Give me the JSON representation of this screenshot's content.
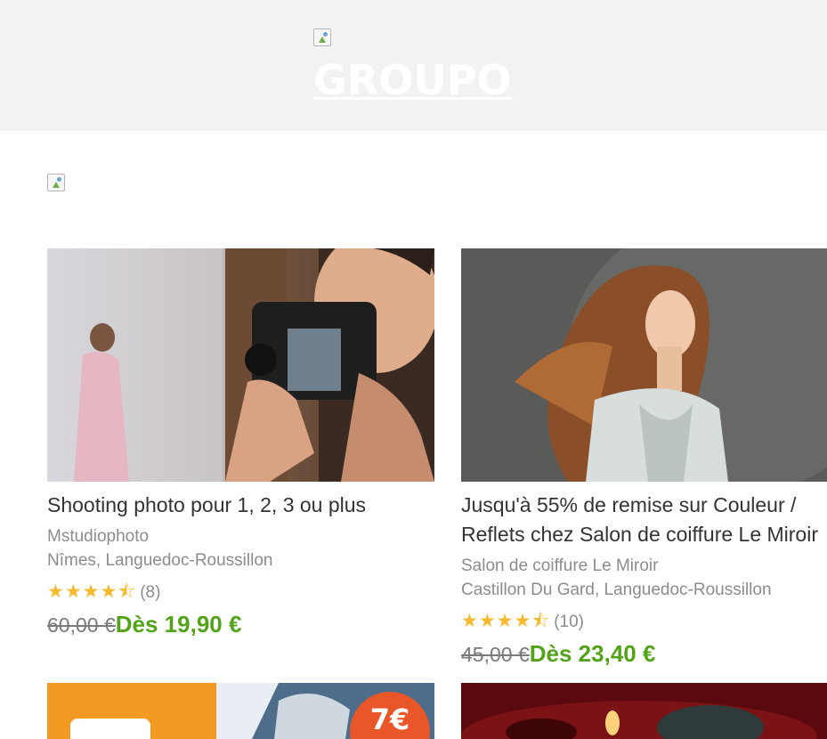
{
  "header": {
    "logo_text": "GROUPO"
  },
  "deals": [
    {
      "title": "Shooting photo pour 1, 2, 3 ou plus",
      "merchant": "Mstudiophoto",
      "location": "Nîmes, Languedoc-Roussillon",
      "rating": 4.5,
      "stars": "★★★★⯪",
      "review_count": "(8)",
      "old_price": "60,00 €",
      "new_price": "Dès 19,90 €"
    },
    {
      "title_line1": "Jusqu'à 55% de remise sur Couleur /",
      "title_line2": "Reflets chez Salon de coiffure Le Miroir",
      "merchant": "Salon de coiffure Le Miroir",
      "location": "Castillon Du Gard, Languedoc-Roussillon",
      "rating": 4.5,
      "stars": "★★★★⯪",
      "review_count": "(10)",
      "old_price": "45,00 €",
      "new_price": "Dès 23,40 €"
    },
    {
      "badge": "7€"
    },
    {}
  ],
  "colors": {
    "accent_green": "#53a318",
    "star": "#f7b92d",
    "header_bg": "#f2f2f2"
  }
}
